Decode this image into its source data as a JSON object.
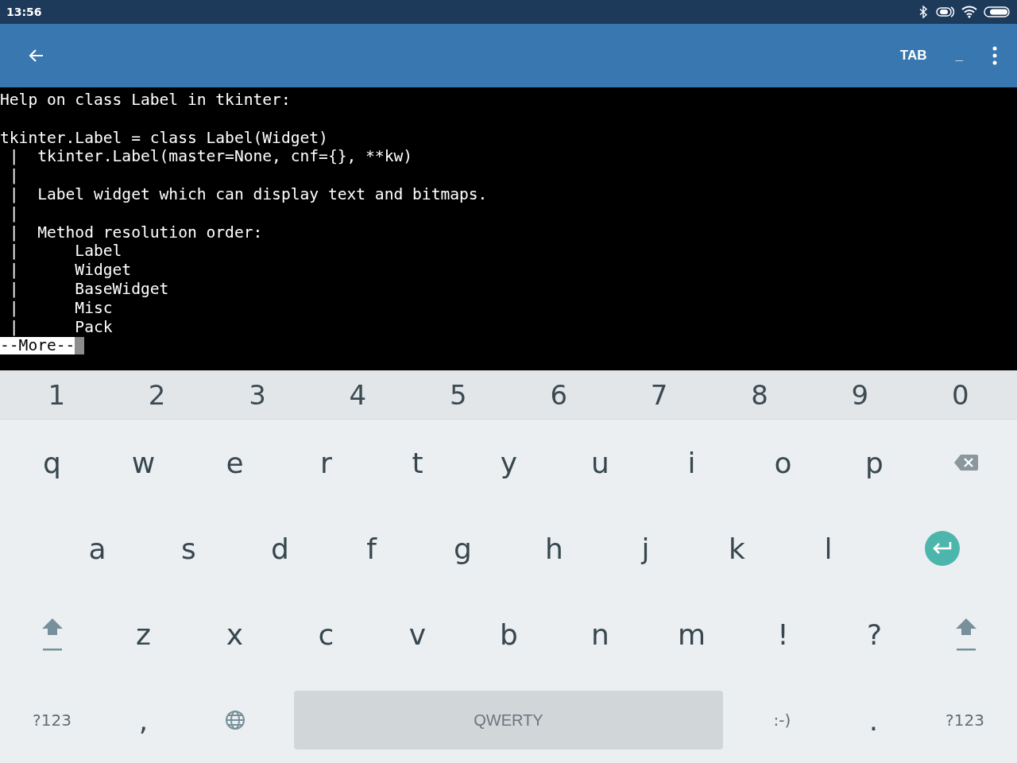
{
  "status_bar": {
    "time": "13:56"
  },
  "toolbar": {
    "actions": [
      {
        "kind": "text",
        "label": "TAB"
      },
      {
        "kind": "text",
        "label": "_"
      },
      {
        "kind": "menu"
      }
    ]
  },
  "terminal": {
    "text": "Help on class Label in tkinter:\n\ntkinter.Label = class Label(Widget)\n |  tkinter.Label(master=None, cnf={}, **kw)\n |\n |  Label widget which can display text and bitmaps.\n |\n |  Method resolution order:\n |      Label\n |      Widget\n |      BaseWidget\n |      Misc\n |      Pack",
    "prompt": "--More--"
  },
  "keyboard": {
    "number_row": [
      "1",
      "2",
      "3",
      "4",
      "5",
      "6",
      "7",
      "8",
      "9",
      "0"
    ],
    "rows": [
      [
        {
          "kind": "char",
          "label": "q"
        },
        {
          "kind": "char",
          "label": "w"
        },
        {
          "kind": "char",
          "label": "e"
        },
        {
          "kind": "char",
          "label": "r"
        },
        {
          "kind": "char",
          "label": "t"
        },
        {
          "kind": "char",
          "label": "y"
        },
        {
          "kind": "char",
          "label": "u"
        },
        {
          "kind": "char",
          "label": "i"
        },
        {
          "kind": "char",
          "label": "o"
        },
        {
          "kind": "char",
          "label": "p"
        },
        {
          "kind": "backspace"
        }
      ],
      [
        {
          "kind": "char",
          "label": "a"
        },
        {
          "kind": "char",
          "label": "s"
        },
        {
          "kind": "char",
          "label": "d"
        },
        {
          "kind": "char",
          "label": "f"
        },
        {
          "kind": "char",
          "label": "g"
        },
        {
          "kind": "char",
          "label": "h"
        },
        {
          "kind": "char",
          "label": "j"
        },
        {
          "kind": "char",
          "label": "k"
        },
        {
          "kind": "char",
          "label": "l"
        },
        {
          "kind": "enter"
        }
      ],
      [
        {
          "kind": "shift"
        },
        {
          "kind": "char",
          "label": "z"
        },
        {
          "kind": "char",
          "label": "x"
        },
        {
          "kind": "char",
          "label": "c"
        },
        {
          "kind": "char",
          "label": "v"
        },
        {
          "kind": "char",
          "label": "b"
        },
        {
          "kind": "char",
          "label": "n"
        },
        {
          "kind": "char",
          "label": "m"
        },
        {
          "kind": "char",
          "label": "!"
        },
        {
          "kind": "char",
          "label": "?"
        },
        {
          "kind": "shift"
        }
      ]
    ],
    "bottom_left": [
      {
        "kind": "small",
        "label": "?123"
      },
      {
        "kind": "char",
        "label": ","
      },
      {
        "kind": "globe"
      }
    ],
    "space_bar": {
      "label": "QWERTY"
    },
    "bottom_right": [
      {
        "kind": "small",
        "label": ":-)"
      },
      {
        "kind": "char",
        "label": "."
      },
      {
        "kind": "small",
        "label": "?123"
      }
    ]
  }
}
